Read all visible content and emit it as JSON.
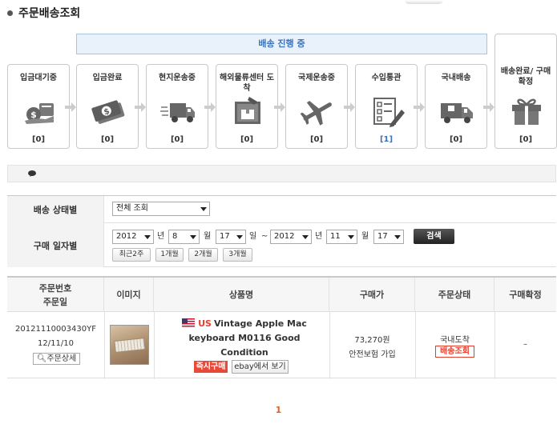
{
  "page": {
    "title": "주문배송조회"
  },
  "progress": {
    "label": "배송 진행 중",
    "steps": [
      {
        "label": "입금대기중",
        "count": "[0]",
        "icon": "coin-hand-icon"
      },
      {
        "label": "입금완료",
        "count": "[0]",
        "icon": "money-icon"
      },
      {
        "label": "현지운송중",
        "count": "[0]",
        "icon": "fast-truck-icon"
      },
      {
        "label": "해외물류센터 도착",
        "count": "[0]",
        "icon": "warehouse-box-icon"
      },
      {
        "label": "국제운송중",
        "count": "[0]",
        "icon": "airplane-icon"
      },
      {
        "label": "수입통관",
        "count": "[1]",
        "icon": "checklist-icon"
      },
      {
        "label": "국내배송",
        "count": "[0]",
        "icon": "truck-icon"
      },
      {
        "label": "배송완료/ 구매확정",
        "count": "[0]",
        "icon": "gift-icon"
      }
    ]
  },
  "filter": {
    "status_label": "배송 상태별",
    "status_value": "전체 조회",
    "date_label": "구매 일자별",
    "from": {
      "year": "2012",
      "month": "8",
      "day": "17"
    },
    "to": {
      "year": "2012",
      "month": "11",
      "day": "17"
    },
    "units": {
      "year": "년",
      "month": "월",
      "day": "일",
      "range": "~"
    },
    "search_label": "검색",
    "periods": [
      "최근2주",
      "1개월",
      "2개월",
      "3개월"
    ]
  },
  "orders": {
    "columns": [
      "주문번호",
      "주문일",
      "이미지",
      "상품명",
      "구매가",
      "주문상태",
      "구매확정"
    ],
    "rows": [
      {
        "order_no": "20121110003430YF",
        "order_date": "12/11/10",
        "detail_label": "주문상세",
        "country": "US",
        "name_line1": "Vintage Apple Mac",
        "name_line2": "keyboard M0116 Good",
        "name_line3": "Condition",
        "buy_now": "즉시구매",
        "ebay_view": "ebay에서 보기",
        "price": "73,270원",
        "insurance": "안전보험 가입",
        "status": "국내도착",
        "track": "배송조회",
        "confirm": "–"
      }
    ]
  },
  "pager": {
    "current": "1"
  },
  "colors": {
    "accent": "#3d73b5",
    "alert": "#e84a3a",
    "pager": "#e2621b"
  }
}
